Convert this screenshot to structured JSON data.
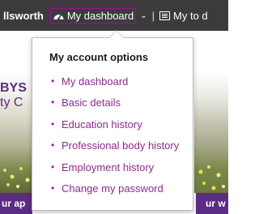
{
  "topbar": {
    "user_name_fragment": "llsworth",
    "dashboard_label": "My dashboard",
    "next_item_fragment": "My to d",
    "separator": "|"
  },
  "background": {
    "heading_fragment": "BYS",
    "sub_fragment": "ty C",
    "cta_left_fragment": "ur ap",
    "cta_right_fragment": "ur w"
  },
  "dropdown": {
    "title": "My account options",
    "items": [
      {
        "label": "My dashboard"
      },
      {
        "label": "Basic details"
      },
      {
        "label": "Education history"
      },
      {
        "label": "Professional body history"
      },
      {
        "label": "Employment history"
      },
      {
        "label": "Change my password"
      }
    ]
  },
  "colors": {
    "topbar_bg": "#3c3a3d",
    "link": "#8e2b8c",
    "brand_purple": "#5b2c84",
    "focus_outline": "#a01090"
  },
  "icons": {
    "dashboard": "dashboard-gauge-icon",
    "chevron": "chevron-down-icon",
    "list": "list-icon"
  }
}
